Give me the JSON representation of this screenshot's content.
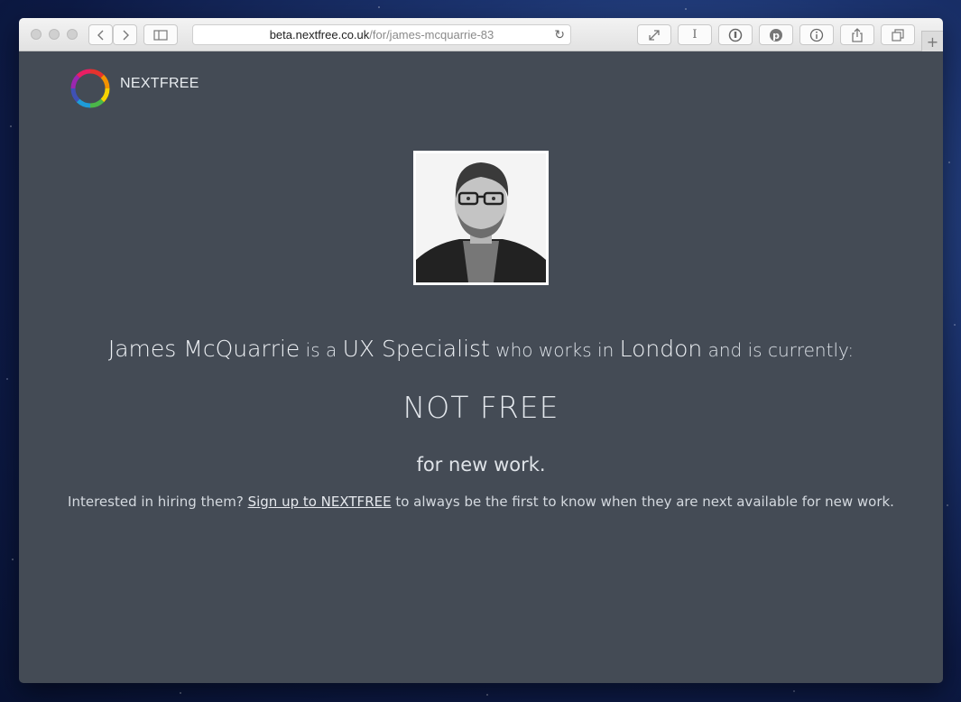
{
  "browser": {
    "url_host": "beta.nextfree.co.uk",
    "url_path": "/for/james-mcquarrie-83",
    "back_icon": "chevron-left-icon",
    "forward_icon": "chevron-right-icon",
    "sidebar_icon": "sidebar-icon",
    "reload_icon": "reload-icon",
    "extensions": [
      "expand-icon",
      "text-cursor-icon",
      "password-icon",
      "pinterest-icon",
      "info-icon",
      "share-icon",
      "tabs-icon"
    ],
    "new_tab_label": "+"
  },
  "site": {
    "brand": "NEXTFREE",
    "logo_icon": "color-ring-logo",
    "logo_colors": [
      "#e5322d",
      "#f39200",
      "#f6d200",
      "#4bb749",
      "#1e9bd7",
      "#3f51b5",
      "#9c27b0",
      "#e91e63"
    ]
  },
  "profile": {
    "name": "James McQuarrie",
    "is_a": "is a",
    "role": "UX Specialist",
    "works_in": "who works in",
    "location": "London",
    "currently": "and is currently:",
    "status": "NOT FREE",
    "for_work": "for new work.",
    "note_prefix": "Interested in hiring them?",
    "note_link": "Sign up to NEXTFREE",
    "note_suffix": "to always be the first to know when they are next available for new work."
  }
}
